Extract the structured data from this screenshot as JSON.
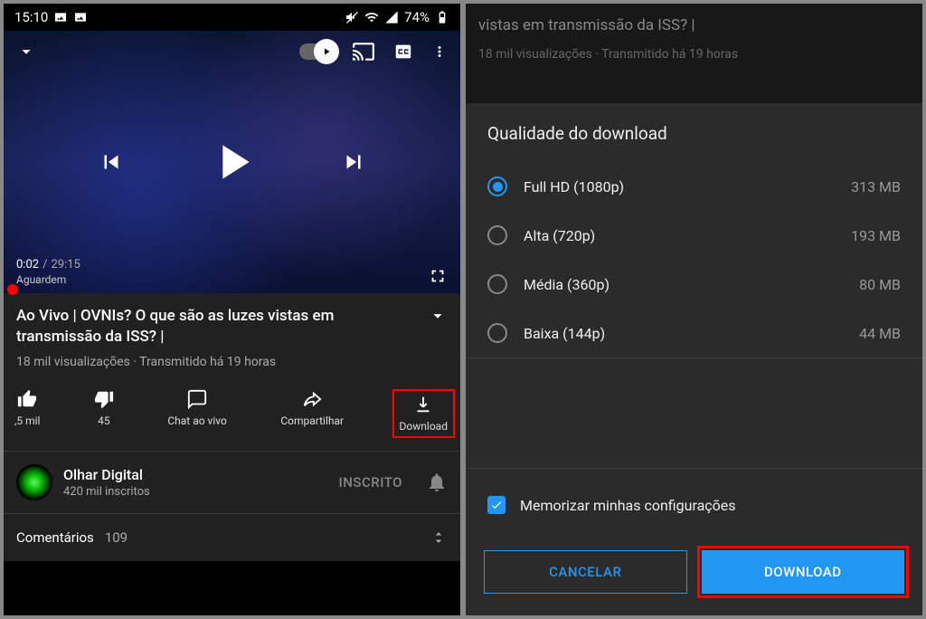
{
  "statusbar": {
    "time": "15:10",
    "battery": "74%"
  },
  "player": {
    "current_time": "0:02",
    "duration": "29:15",
    "waiting_text": "Aguardem"
  },
  "video": {
    "title": "Ao Vivo | OVNIs? O que são as luzes vistas em transmissão da ISS? |",
    "meta": "18 mil visualizações · Transmitido há 19 horas"
  },
  "actions": {
    "like_count": ",5 mil",
    "dislike_count": "45",
    "chat_label": "Chat ao vivo",
    "share_label": "Compartilhar",
    "download_label": "Download"
  },
  "channel": {
    "name": "Olhar Digital",
    "subs": "420 mil inscritos",
    "subscribed_label": "INSCRITO"
  },
  "comments": {
    "label": "Comentários",
    "count": "109"
  },
  "dialog": {
    "bg_title_fragment": "vistas em transmissão da ISS? |",
    "bg_meta": "18 mil visualizações · Transmitido há 19 horas",
    "title": "Qualidade do download",
    "options": [
      {
        "label": "Full HD (1080p)",
        "size": "313 MB",
        "selected": true
      },
      {
        "label": "Alta (720p)",
        "size": "193 MB",
        "selected": false
      },
      {
        "label": "Média (360p)",
        "size": "80 MB",
        "selected": false
      },
      {
        "label": "Baixa (144p)",
        "size": "44 MB",
        "selected": false
      }
    ],
    "remember_label": "Memorizar minhas configurações",
    "cancel_label": "CANCELAR",
    "download_label": "DOWNLOAD"
  }
}
